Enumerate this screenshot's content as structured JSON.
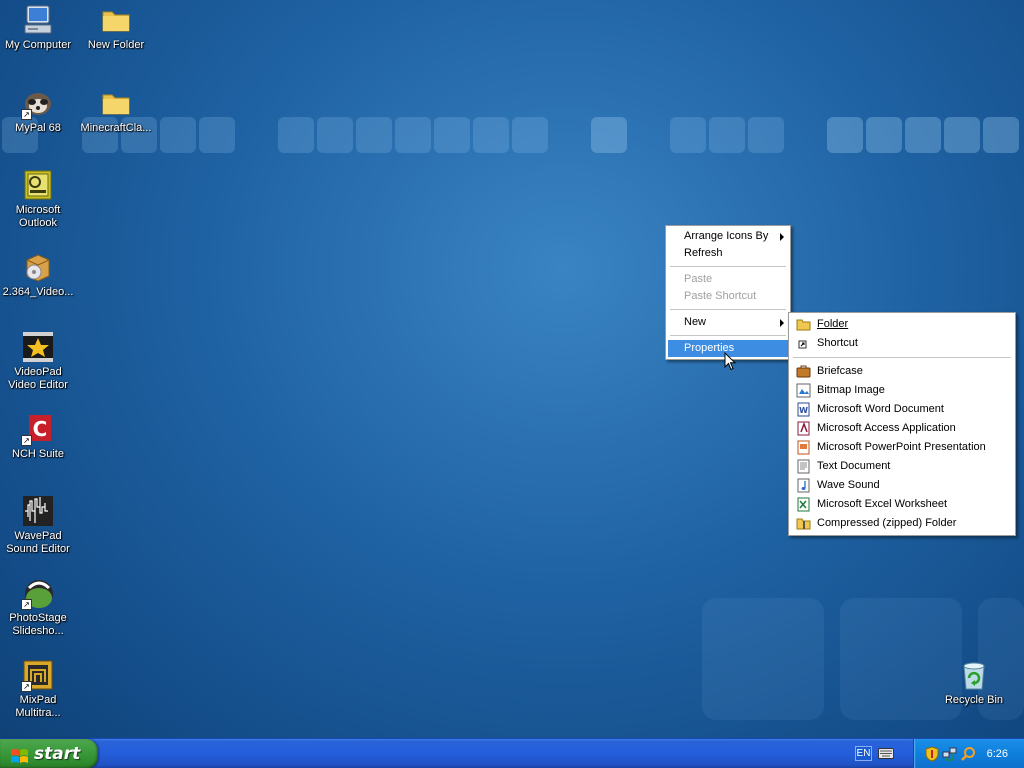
{
  "desktop": {
    "icons": [
      {
        "label": "My Computer",
        "icon": "my-computer-icon"
      },
      {
        "label": "New Folder",
        "icon": "folder-icon"
      },
      {
        "label": "MyPal 68",
        "icon": "mypal-icon"
      },
      {
        "label": "MinecraftCla...",
        "icon": "folder-icon"
      },
      {
        "label": "Microsoft Outlook",
        "icon": "outlook-icon"
      },
      {
        "label": "2.364_Video...",
        "icon": "installer-box-icon"
      },
      {
        "label": "VideoPad Video Editor",
        "icon": "videopad-icon"
      },
      {
        "label": "NCH Suite",
        "icon": "nch-suite-icon"
      },
      {
        "label": "WavePad Sound Editor",
        "icon": "wavepad-icon"
      },
      {
        "label": "PhotoStage Slidesho...",
        "icon": "photostage-icon"
      },
      {
        "label": "MixPad Multitra...",
        "icon": "mixpad-icon"
      },
      {
        "label": "Recycle Bin",
        "icon": "recycle-bin-icon"
      }
    ]
  },
  "context_menu": {
    "items": [
      {
        "label": "Arrange Icons By"
      },
      {
        "label": "Refresh"
      },
      {
        "label": "Paste"
      },
      {
        "label": "Paste Shortcut"
      },
      {
        "label": "New"
      },
      {
        "label": "Properties"
      }
    ]
  },
  "new_submenu": {
    "items": [
      {
        "label": "Folder",
        "icon": "folder-icon"
      },
      {
        "label": "Shortcut",
        "icon": "shortcut-icon"
      },
      {
        "label": "Briefcase",
        "icon": "briefcase-icon"
      },
      {
        "label": "Bitmap Image",
        "icon": "bitmap-icon"
      },
      {
        "label": "Microsoft Word Document",
        "icon": "word-doc-icon"
      },
      {
        "label": "Microsoft Access Application",
        "icon": "access-icon"
      },
      {
        "label": "Microsoft PowerPoint Presentation",
        "icon": "powerpoint-icon"
      },
      {
        "label": "Text Document",
        "icon": "text-doc-icon"
      },
      {
        "label": "Wave Sound",
        "icon": "wave-sound-icon"
      },
      {
        "label": "Microsoft Excel Worksheet",
        "icon": "excel-icon"
      },
      {
        "label": "Compressed (zipped) Folder",
        "icon": "zip-folder-icon"
      }
    ]
  },
  "taskbar": {
    "start_label": "start",
    "language": "EN",
    "clock": "6:26"
  }
}
